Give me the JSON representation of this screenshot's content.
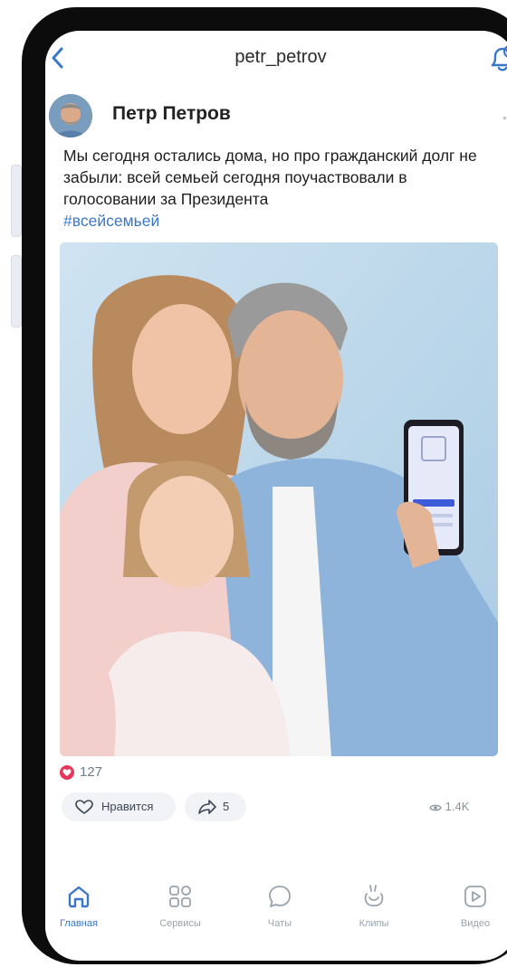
{
  "header": {
    "title": "petr_petrov",
    "back_icon": "chevron-left-icon",
    "bell_icon": "bell-plus-icon"
  },
  "post": {
    "author_name": "Петр Петров",
    "text": "Мы сегодня остались дома, но про гражданский долг не забыли: всей семьей сегодня поучаствовали в голосовании за Президента",
    "hashtag": "#всейсемьей",
    "likes_count": "127",
    "like_label": "Нравится",
    "share_count": "5",
    "views": "1.4K"
  },
  "tabbar": {
    "items": [
      {
        "label": "Главная",
        "icon": "home-icon",
        "active": true
      },
      {
        "label": "Сервисы",
        "icon": "services-icon",
        "active": false
      },
      {
        "label": "Чаты",
        "icon": "chat-icon",
        "active": false
      },
      {
        "label": "Клипы",
        "icon": "clips-icon",
        "active": false
      },
      {
        "label": "Видео",
        "icon": "video-icon",
        "active": false
      }
    ]
  },
  "colors": {
    "accent": "#3a77c9",
    "like_red": "#e8365a",
    "phone_frame": "#0c0c0c"
  }
}
